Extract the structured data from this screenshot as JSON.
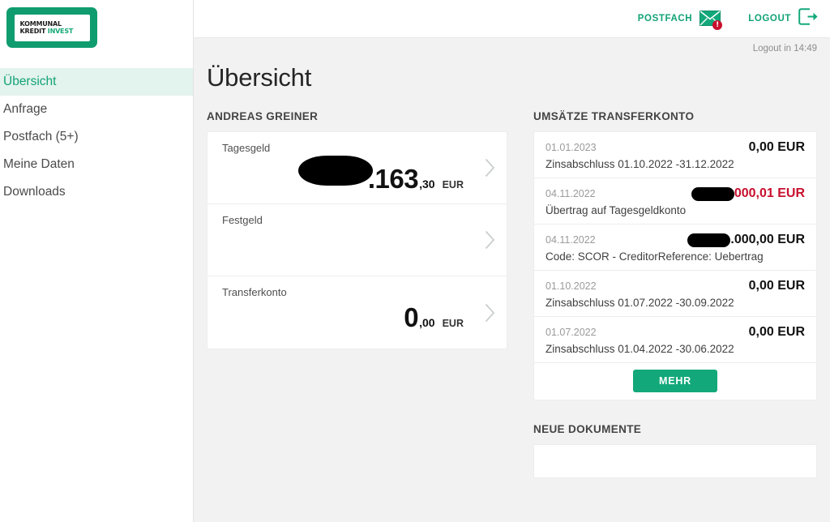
{
  "brand": {
    "logo_line1": "KOMMUNAL",
    "logo_line2_a": "KREDIT ",
    "logo_line2_b": "INVEST",
    "green": "#0f9c6e",
    "accent_green": "#13a87a",
    "active_bg": "#e3f3ed",
    "negative_red": "#c8102e"
  },
  "sidebar": {
    "items": [
      {
        "label": "Übersicht",
        "active": true
      },
      {
        "label": "Anfrage",
        "active": false
      },
      {
        "label": "Postfach (5+)",
        "active": false
      },
      {
        "label": "Meine Daten",
        "active": false
      },
      {
        "label": "Downloads",
        "active": false
      }
    ]
  },
  "topbar": {
    "postfach_label": "POSTFACH",
    "postfach_icon": "envelope-icon",
    "postfach_badge": "!",
    "logout_label": "LOGOUT",
    "logout_icon": "logout-icon",
    "session_timer": "Logout in 14:49"
  },
  "page": {
    "title": "Übersicht"
  },
  "accounts": {
    "section_label": "ANDREAS GREINER",
    "rows": [
      {
        "name": "Tagesgeld",
        "redacted": true,
        "main": ".163",
        "decimals": ",30",
        "currency": "EUR"
      },
      {
        "name": "Festgeld",
        "redacted": false,
        "main": "",
        "decimals": "",
        "currency": ""
      },
      {
        "name": "Transferkonto",
        "redacted": false,
        "main": "0",
        "decimals": ",00",
        "currency": "EUR"
      }
    ]
  },
  "transactions": {
    "section_label": "UMSÄTZE TRANSFERKONTO",
    "rows": [
      {
        "date": "01.01.2023",
        "amount": "0,00 EUR",
        "redacted": false,
        "negative": false,
        "description": "Zinsabschluss 01.10.2022 -31.12.2022"
      },
      {
        "date": "04.11.2022",
        "amount": "000,01 EUR",
        "redacted": true,
        "negative": true,
        "description": "Übertrag auf Tagesgeldkonto"
      },
      {
        "date": "04.11.2022",
        "amount": ".000,00 EUR",
        "redacted": true,
        "negative": false,
        "description": "Code: SCOR - CreditorReference: Uebertrag"
      },
      {
        "date": "01.10.2022",
        "amount": "0,00 EUR",
        "redacted": false,
        "negative": false,
        "description": "Zinsabschluss 01.07.2022 -30.09.2022"
      },
      {
        "date": "01.07.2022",
        "amount": "0,00 EUR",
        "redacted": false,
        "negative": false,
        "description": "Zinsabschluss 01.04.2022 -30.06.2022"
      }
    ],
    "more_button": "MEHR"
  },
  "documents": {
    "section_label": "NEUE DOKUMENTE"
  }
}
